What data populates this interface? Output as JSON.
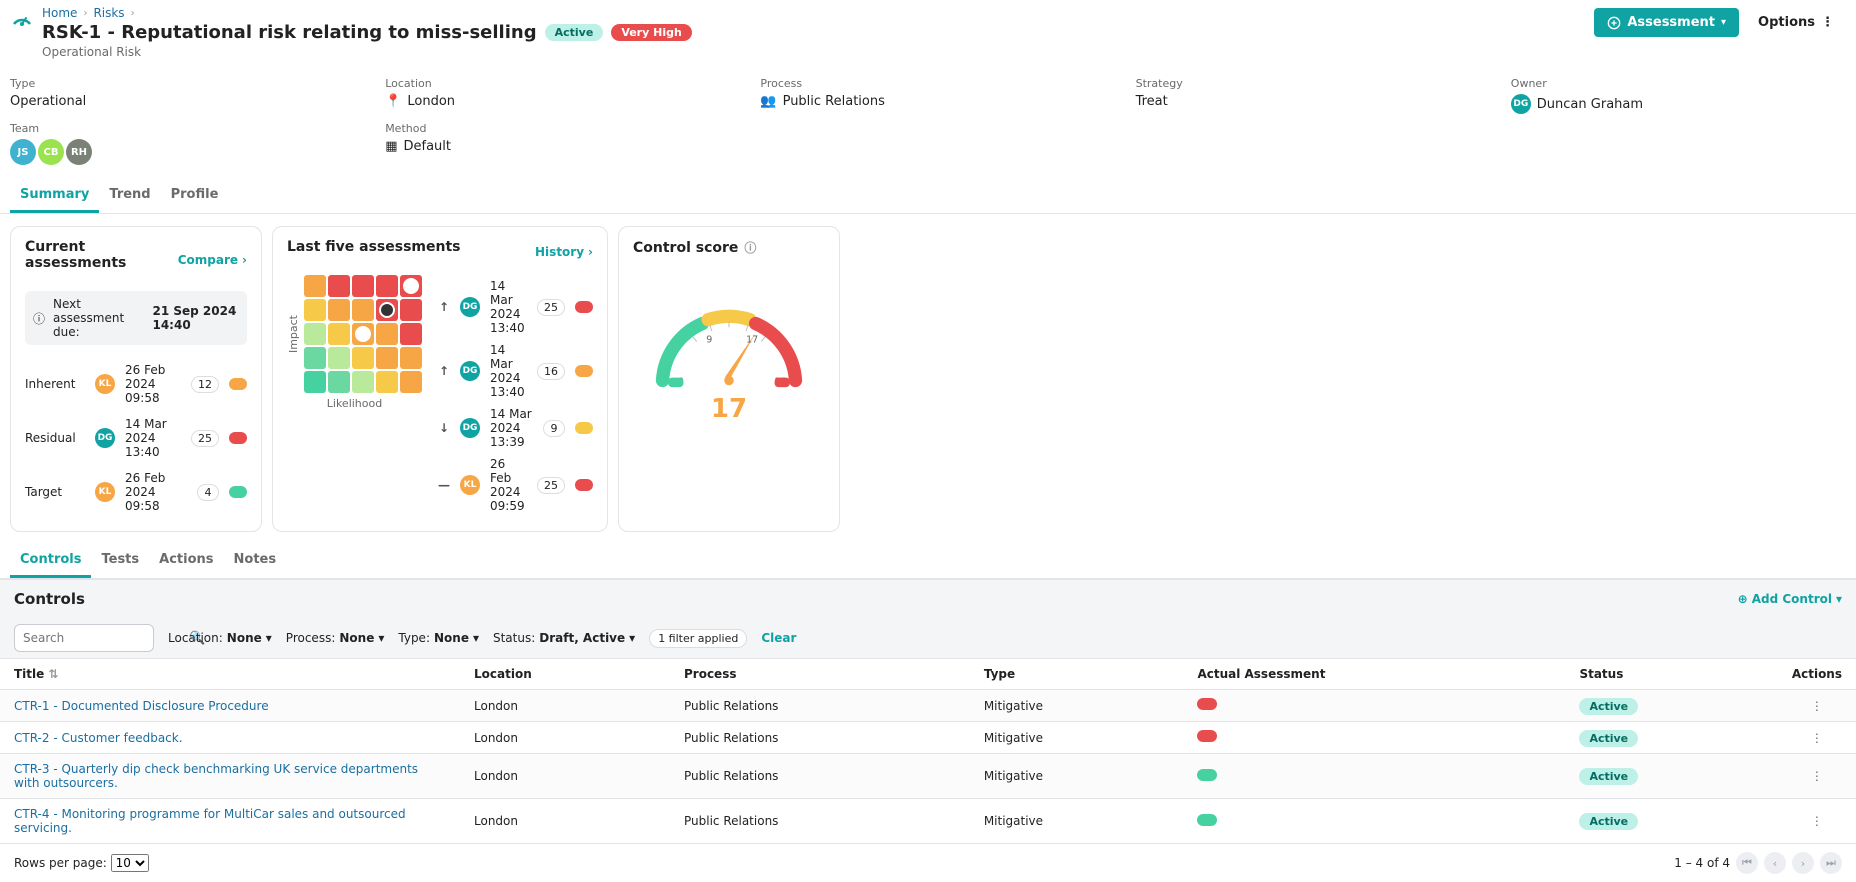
{
  "breadcrumb": {
    "items": [
      "Home",
      "Risks"
    ]
  },
  "header": {
    "title": "RSK-1 - Reputational risk relating to miss-selling",
    "status": "Active",
    "severity": "Very High",
    "subtitle": "Operational Risk",
    "assessment_btn": "Assessment",
    "options_btn": "Options"
  },
  "meta": {
    "type_label": "Type",
    "type": "Operational",
    "location_label": "Location",
    "location": "London",
    "process_label": "Process",
    "process": "Public Relations",
    "strategy_label": "Strategy",
    "strategy": "Treat",
    "owner_label": "Owner",
    "owner_name": "Duncan Graham",
    "owner_initials": "DG",
    "owner_color": "#0fa3a3",
    "team_label": "Team",
    "team": [
      {
        "initials": "JS",
        "color": "#3fb2d0"
      },
      {
        "initials": "CB",
        "color": "#9be24f"
      },
      {
        "initials": "RH",
        "color": "#7a8177"
      }
    ],
    "method_label": "Method",
    "method": "Default"
  },
  "main_tabs": [
    "Summary",
    "Trend",
    "Profile"
  ],
  "card1": {
    "title": "Current assessments",
    "compare": "Compare",
    "notice_label": "Next assessment due:",
    "notice_date": "21 Sep 2024 14:40",
    "rows": [
      {
        "label": "Inherent",
        "initials": "KL",
        "av": "#f7a646",
        "date": "26 Feb 2024 09:58",
        "score": "12",
        "color": "orange"
      },
      {
        "label": "Residual",
        "initials": "DG",
        "av": "#0fa3a3",
        "date": "14 Mar 2024 13:40",
        "score": "25",
        "color": "red"
      },
      {
        "label": "Target",
        "initials": "KL",
        "av": "#f7a646",
        "date": "26 Feb 2024 09:58",
        "score": "4",
        "color": "green"
      }
    ]
  },
  "card2": {
    "title": "Last five assessments",
    "history": "History",
    "xlabel": "Likelihood",
    "ylabel": "Impact",
    "rows": [
      {
        "trend": "↑",
        "initials": "DG",
        "av": "#0fa3a3",
        "date": "14 Mar 2024 13:40",
        "score": "25",
        "color": "red"
      },
      {
        "trend": "↑",
        "initials": "DG",
        "av": "#0fa3a3",
        "date": "14 Mar 2024 13:40",
        "score": "16",
        "color": "orange"
      },
      {
        "trend": "↓",
        "initials": "DG",
        "av": "#0fa3a3",
        "date": "14 Mar 2024 13:39",
        "score": "9",
        "color": "yellow"
      },
      {
        "trend": "—",
        "initials": "KL",
        "av": "#f7a646",
        "date": "26 Feb 2024 09:59",
        "score": "25",
        "color": "red"
      }
    ]
  },
  "card3": {
    "title": "Control score",
    "min": "0",
    "mid1": "9",
    "mid2": "17",
    "max": "25",
    "score": "17"
  },
  "chart_data": {
    "heatmap": {
      "type": "heatmap",
      "xlabel": "Likelihood",
      "ylabel": "Impact",
      "grid_size": 5,
      "colors": [
        [
          "#f7a646",
          "#e84c4c",
          "#e84c4c",
          "#e84c4c",
          "#e84c4c"
        ],
        [
          "#f7c948",
          "#f7a646",
          "#f7a646",
          "#e84c4c",
          "#e84c4c"
        ],
        [
          "#b9e99a",
          "#f7c948",
          "#f7a646",
          "#f7a646",
          "#e84c4c"
        ],
        [
          "#6bd8a2",
          "#b9e99a",
          "#f7c948",
          "#f7a646",
          "#f7a646"
        ],
        [
          "#46d2a0",
          "#6bd8a2",
          "#b9e99a",
          "#f7c948",
          "#f7a646"
        ]
      ],
      "marks": [
        {
          "row": 0,
          "col": 4,
          "style": "open"
        },
        {
          "row": 1,
          "col": 3,
          "style": "filled"
        },
        {
          "row": 2,
          "col": 2,
          "style": "open"
        }
      ]
    },
    "gauge": {
      "type": "gauge",
      "min": 0,
      "max": 25,
      "value": 17,
      "ticks": [
        0,
        9,
        17,
        25
      ],
      "bands": [
        {
          "from": 0,
          "to": 8,
          "color": "#46d2a0"
        },
        {
          "from": 8,
          "to": 17,
          "color": "#f7c948"
        },
        {
          "from": 17,
          "to": 25,
          "color": "#e84c4c"
        }
      ]
    }
  },
  "sec_tabs": [
    "Controls",
    "Tests",
    "Actions",
    "Notes"
  ],
  "controls": {
    "heading": "Controls",
    "add": "Add Control",
    "search_ph": "Search",
    "f_location_label": "Location:",
    "f_location_val": "None",
    "f_process_label": "Process:",
    "f_process_val": "None",
    "f_type_label": "Type:",
    "f_type_val": "None",
    "f_status_label": "Status:",
    "f_status_val": "Draft, Active",
    "filter_chip": "1 filter applied",
    "clear": "Clear",
    "cols": {
      "title": "Title",
      "location": "Location",
      "process": "Process",
      "type": "Type",
      "assessment": "Actual Assessment",
      "status": "Status",
      "actions": "Actions"
    },
    "rows": [
      {
        "title": "CTR-1 - Documented Disclosure Procedure",
        "location": "London",
        "process": "Public Relations",
        "type": "Mitigative",
        "assess": "red",
        "status": "Active"
      },
      {
        "title": "CTR-2 - Customer feedback.",
        "location": "London",
        "process": "Public Relations",
        "type": "Mitigative",
        "assess": "red",
        "status": "Active"
      },
      {
        "title": "CTR-3 - Quarterly dip check benchmarking UK service departments with outsourcers.",
        "location": "London",
        "process": "Public Relations",
        "type": "Mitigative",
        "assess": "green",
        "status": "Active"
      },
      {
        "title": "CTR-4 - Monitoring programme for MultiCar sales and outsourced servicing.",
        "location": "London",
        "process": "Public Relations",
        "type": "Mitigative",
        "assess": "green",
        "status": "Active"
      }
    ],
    "rpp_label": "Rows per page:",
    "rpp_value": "10",
    "range": "1 – 4 of 4"
  }
}
